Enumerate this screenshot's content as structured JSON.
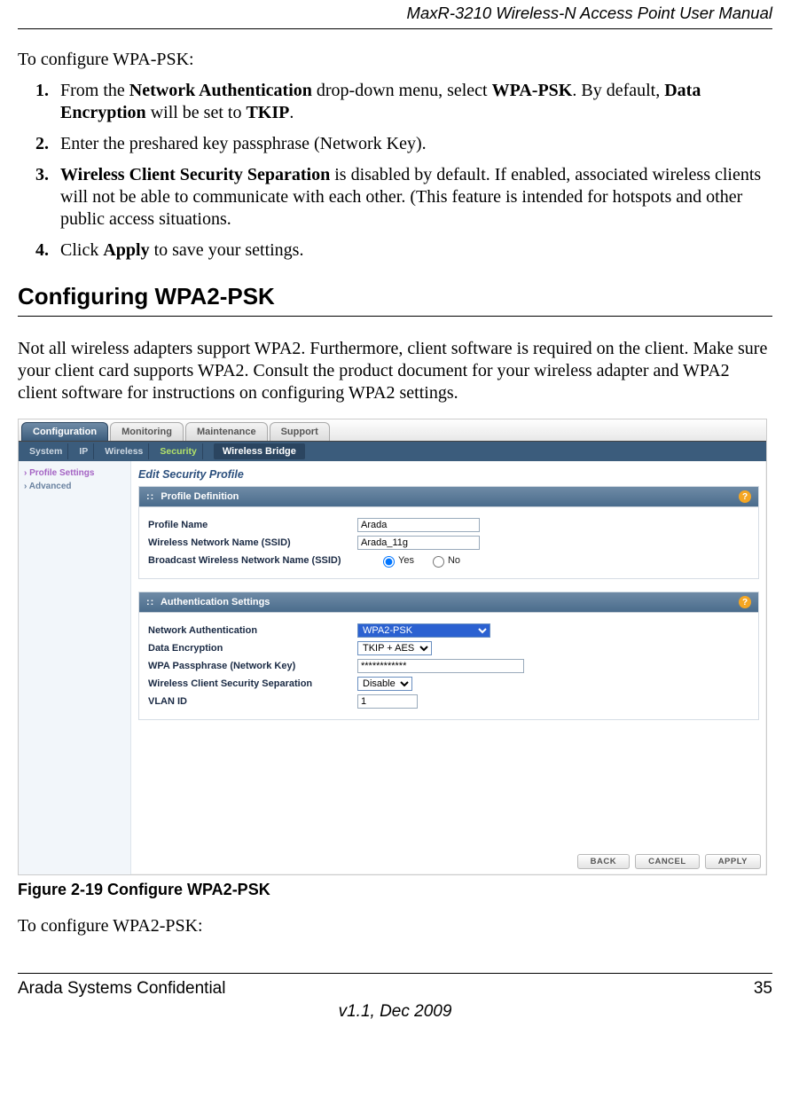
{
  "header": "MaxR-3210 Wireless-N Access Point User Manual",
  "intro1": "To configure WPA-PSK:",
  "steps": [
    {
      "pre": "From the ",
      "b1": "Network Authentication",
      "mid1": " drop-down menu, select ",
      "b2": "WPA-PSK",
      "mid2": ". By default, ",
      "b3": "Data Encryption",
      "mid3": " will be set to ",
      "b4": "TKIP",
      "tail": "."
    },
    {
      "plain": "Enter the preshared key passphrase (Network Key)."
    },
    {
      "b1": "Wireless Client Security Separation",
      "tail": " is disabled by default. If enabled, associated wireless clients will not be able to communicate with each other. (This feature is intended for hotspots and other public access situations."
    },
    {
      "pre": "Click ",
      "b1": "Apply",
      "tail": " to save your settings."
    }
  ],
  "section_title": "Configuring WPA2-PSK",
  "para2": "Not all wireless adapters support WPA2. Furthermore, client software is required on the client. Make sure your client card supports WPA2. Consult the product document for your wireless adapter and WPA2 client software for instructions on configuring WPA2 settings.",
  "figure_caption": "Figure 2-19  Configure WPA2-PSK",
  "intro2": "To configure WPA2-PSK:",
  "footer_left": "Arada Systems Confidential",
  "footer_right": "35",
  "footer_center": "v1.1, Dec 2009",
  "ui": {
    "tabs_outer": [
      "Configuration",
      "Monitoring",
      "Maintenance",
      "Support"
    ],
    "active_outer": 0,
    "subnav": [
      "System",
      "IP",
      "Wireless",
      "Security"
    ],
    "subnav_active": 3,
    "subnav_extra": "Wireless Bridge",
    "left": [
      "Profile Settings",
      "Advanced"
    ],
    "left_active": 0,
    "panel_title": "Edit Security Profile",
    "group1": {
      "title": "Profile Definition",
      "profile_name_lbl": "Profile Name",
      "profile_name_val": "Arada",
      "ssid_lbl": "Wireless Network Name (SSID)",
      "ssid_val": "Arada_11g",
      "broadcast_lbl": "Broadcast Wireless Network Name (SSID)",
      "broadcast_yes": "Yes",
      "broadcast_no": "No"
    },
    "group2": {
      "title": "Authentication Settings",
      "netauth_lbl": "Network Authentication",
      "netauth_val": "WPA2-PSK",
      "dataenc_lbl": "Data Encryption",
      "dataenc_val": "TKIP + AES",
      "passphrase_lbl": "WPA Passphrase (Network Key)",
      "passphrase_val": "************",
      "sep_lbl": "Wireless Client Security Separation",
      "sep_val": "Disable",
      "vlan_lbl": "VLAN ID",
      "vlan_val": "1"
    },
    "buttons": {
      "back": "BACK",
      "cancel": "CANCEL",
      "apply": "APPLY"
    }
  }
}
